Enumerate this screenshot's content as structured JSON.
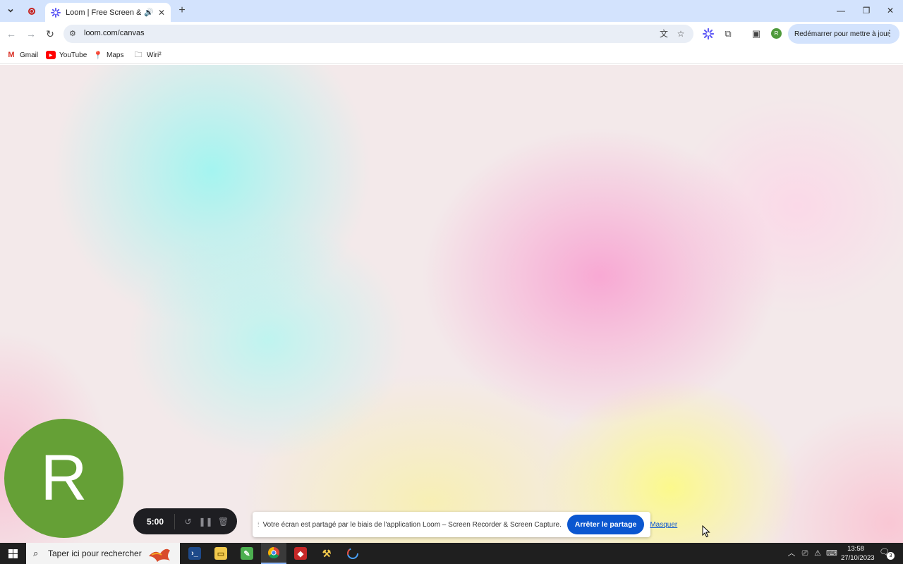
{
  "browser": {
    "tab_title": "Loom | Free Screen & Video Recording Software",
    "tab_icons": [
      "tab-search-icon",
      "recording-icon",
      "loom-icon",
      "audio-icon",
      "close-icon",
      "plus-icon"
    ],
    "url": "loom.com/canvas",
    "update_button_label": "Redémarrer pour mettre à jour",
    "profile_initial": "R"
  },
  "bookmarks": [
    {
      "label": "Gmail",
      "icon": "gmail-icon"
    },
    {
      "label": "YouTube",
      "icon": "youtube-icon"
    },
    {
      "label": "Maps",
      "icon": "maps-icon"
    },
    {
      "label": "Wiri²",
      "icon": "folder-icon"
    }
  ],
  "loom": {
    "camera_initial": "R",
    "camera_color": "#65a036",
    "timer": "5:00",
    "controls": [
      "restart-icon",
      "pause-icon",
      "trash-icon"
    ]
  },
  "share_bar": {
    "message": "Votre écran est partagé par le biais de l'application Loom – Screen Recorder & Screen Capture.",
    "stop_label": "Arrêter le partage",
    "hide_label": "Masquer"
  },
  "taskbar": {
    "search_placeholder": "Taper ici pour rechercher",
    "time": "13:58",
    "date": "27/10/2023",
    "notification_count": "3",
    "apps": [
      "powershell-icon",
      "file-explorer-icon",
      "notepad-icon",
      "chrome-icon",
      "media-icon",
      "tools-icon",
      "loom-app-icon"
    ]
  },
  "colors": {
    "tabstrip": "#d3e3fd",
    "accent": "#0b57d0",
    "taskbar": "#1f1f1f"
  }
}
